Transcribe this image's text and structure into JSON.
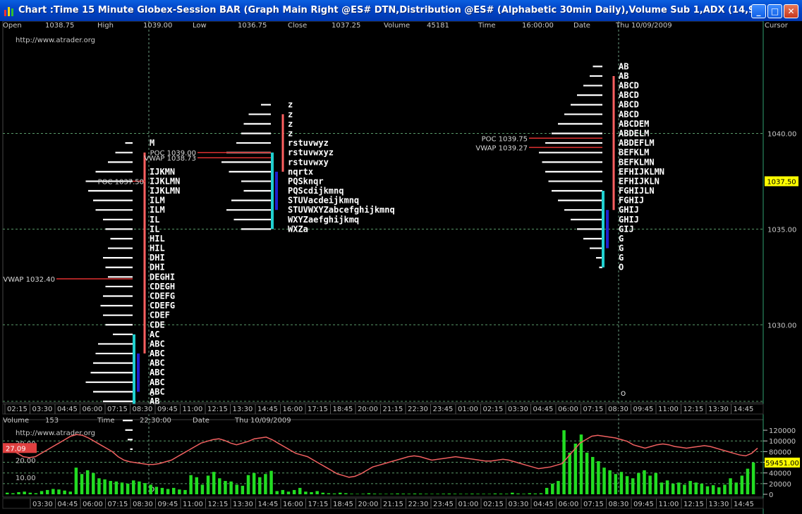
{
  "window": {
    "title": "Chart :Time 15 Minute Globex-Session BAR (Graph Main Right @ES# DTN,Distribution @ES# (Alphabetic 30min Daily),Volume Sub 1,ADX (14,9))",
    "minimize_glyph": "_",
    "maximize_glyph": "□",
    "close_glyph": "✕"
  },
  "main_header": {
    "fields": [
      {
        "label": "Open",
        "value": "1038.75"
      },
      {
        "label": "High",
        "value": "1039.00"
      },
      {
        "label": "Low",
        "value": "1036.75"
      },
      {
        "label": "Close",
        "value": "1037.25"
      },
      {
        "label": "Volume",
        "value": "45181"
      },
      {
        "label": "Time",
        "value": "16:00:00"
      },
      {
        "label": "Date",
        "value": "Thu 10/09/2009"
      }
    ],
    "cursor_label": "Cursor"
  },
  "watermark": "http://www.atrader.org",
  "colors": {
    "profile": "#ffffff",
    "poc_line": "#e03030",
    "value_area": "#ff6060",
    "ib_cyan": "#20d0d0",
    "ib_blue": "#2020d0",
    "price_highlight": "#ffff00",
    "volume_bar": "#22dd22",
    "adx_line": "#f06060",
    "grid": "#5a9a6a"
  },
  "main_axis": {
    "ticks": [
      "1040.00",
      "1035.00",
      "1030.00"
    ],
    "tick_values": [
      1040,
      1035,
      1030
    ],
    "current_price": "1037.50",
    "current_value": 1037.5
  },
  "time_axis": [
    "02:15",
    "03:30",
    "04:45",
    "06:00",
    "07:15",
    "08:30",
    "09:45",
    "11:00",
    "12:15",
    "13:30",
    "14:45",
    "16:00",
    "17:15",
    "18:45",
    "20:00",
    "21:15",
    "22:30",
    "23:45",
    "01:00",
    "02:15",
    "03:30",
    "04:45",
    "06:00",
    "07:15",
    "08:30",
    "09:45",
    "11:00",
    "12:15",
    "13:30",
    "14:45"
  ],
  "sub_time_axis": [
    "03:30",
    "04:45",
    "06:00",
    "07:15",
    "08:30",
    "09:45",
    "11:00",
    "12:15",
    "13:30",
    "14:45",
    "16:00",
    "17:15",
    "18:45",
    "20:00",
    "21:15",
    "22:30",
    "23:45",
    "01:00",
    "02:15",
    "03:30",
    "04:45",
    "06:00",
    "07:15",
    "08:30",
    "09:45",
    "11:00",
    "12:15",
    "13:30",
    "14:45"
  ],
  "sub_header": {
    "fields": [
      {
        "label": "Volume",
        "value": "153"
      },
      {
        "label": "Time",
        "value": "22:30:00"
      },
      {
        "label": "Date",
        "value": "Thu 10/09/2009"
      }
    ]
  },
  "sub_axis": {
    "ticks": [
      "120000",
      "100000",
      "80000",
      "60000",
      "40000",
      "20000",
      "0"
    ],
    "tick_values": [
      120000,
      100000,
      80000,
      60000,
      40000,
      20000,
      0
    ],
    "current_volume": "59451.00",
    "current_volume_value": 59451,
    "left_ticks": [
      "30.00",
      "20.00",
      "10.00"
    ],
    "left_tick_values": [
      30,
      20,
      10
    ],
    "adx_value": "27.09",
    "adx_value_num": 27.09
  },
  "session_markers": [
    "O",
    "O",
    "O"
  ],
  "chart_data": {
    "type": "market-profile",
    "profiles": [
      {
        "name": "session-1",
        "poc_label": "POC 1037.50",
        "poc": 1037.5,
        "vwap_label": "VWAP 1032.40",
        "vwap": 1032.4,
        "letters": [
          "M",
          "",
          "",
          "IJKMN",
          "IJKLMN",
          "IJKLMN",
          "ILM",
          "ILM",
          "IL",
          "IL",
          "HIL",
          "HIL",
          "DHI",
          "DHI",
          "DEGHI",
          "CDEGH",
          "CDEFG",
          "CDEFG",
          "CDEF",
          "CDE",
          "AC",
          "ABC",
          "ABC",
          "ABC",
          "ABC",
          "ABC",
          "ABC",
          "AB",
          "O"
        ],
        "top_price": 1039.5,
        "step": 0.5,
        "widths": [
          0.15,
          0.35,
          0.5,
          0.75,
          0.95,
          0.9,
          0.8,
          0.75,
          0.6,
          0.55,
          0.45,
          0.5,
          0.6,
          0.55,
          0.5,
          0.55,
          0.6,
          0.65,
          0.6,
          0.55,
          0.4,
          0.7,
          0.75,
          0.8,
          0.85,
          0.95,
          0.8,
          0.6,
          0.3,
          0.2,
          0.15,
          0.1,
          0.05
        ]
      },
      {
        "name": "session-2",
        "poc_label": "POC 1039.00",
        "poc": 1039.0,
        "vwap_label": "VWAP 1038.73",
        "vwap": 1038.73,
        "letters": [
          "z",
          "z",
          "z",
          "z",
          "rstuvwyz",
          "rstuvwxyz",
          "rstuvwxy",
          "nqrtx",
          "PQSknqr",
          "PQScdijkmnq",
          "STUVacdeijkmnq",
          "STUVWXYZabcefghijkmnq",
          "WXYZaefghijkmq",
          "WXZa"
        ],
        "top_price": 1041.5,
        "step": 0.5,
        "widths": [
          0.2,
          0.45,
          0.55,
          0.6,
          0.7,
          0.9,
          1.0,
          0.85,
          0.6,
          0.55,
          0.8,
          0.9,
          0.75,
          0.6
        ]
      },
      {
        "name": "session-3",
        "poc_label": "POC 1039.75",
        "poc": 1039.75,
        "vwap_label": "VWAP 1039.27",
        "vwap": 1039.27,
        "letters": [
          "AB",
          "AB",
          "ABCD",
          "ABCD",
          "ABCD",
          "ABCD",
          "ABCDEM",
          "ABDELM",
          "ABDEFLM",
          "BEFKLM",
          "BEFKLMN",
          "EFHIJKLMN",
          "EFHIJKLN",
          "FGHIJLN",
          "FGHIJ",
          "GHIJ",
          "GHIJ",
          "GIJ",
          "G",
          "G",
          "G",
          "O"
        ],
        "top_price": 1043.5,
        "step": 0.5,
        "widths": [
          0.15,
          0.2,
          0.3,
          0.4,
          0.5,
          0.6,
          0.7,
          0.8,
          0.9,
          1.0,
          0.95,
          0.9,
          0.85,
          0.8,
          0.7,
          0.6,
          0.5,
          0.4,
          0.3,
          0.2,
          0.1,
          0.05
        ]
      }
    ],
    "volume_series": {
      "name": "Volume",
      "values": [
        3000,
        2000,
        4000,
        5000,
        3000,
        2000,
        6000,
        8000,
        10000,
        9000,
        7000,
        5000,
        50000,
        38000,
        45000,
        40000,
        30000,
        28000,
        25000,
        24000,
        22000,
        20000,
        26000,
        24000,
        21000,
        18000,
        14000,
        12000,
        10000,
        12000,
        9000,
        8000,
        36000,
        32000,
        18000,
        35000,
        42000,
        30000,
        25000,
        24000,
        18000,
        16000,
        36000,
        40000,
        32000,
        38000,
        44000,
        6000,
        8000,
        5000,
        8000,
        12000,
        5000,
        4000,
        6000,
        3000,
        2000,
        1500,
        3000,
        2000,
        1000,
        800,
        1000,
        2000,
        1200,
        900,
        800,
        1000,
        1500,
        1200,
        1000,
        1400,
        1200,
        900,
        800,
        900,
        1100,
        1300,
        1000,
        900,
        800,
        1200,
        1000,
        900,
        800,
        1500,
        1200,
        1000,
        3000,
        1500,
        1000,
        2000,
        1500,
        2000,
        12000,
        20000,
        25000,
        120000,
        78000,
        95000,
        112000,
        78000,
        70000,
        62000,
        50000,
        45000,
        38000,
        42000,
        34000,
        30000,
        40000,
        45000,
        35000,
        40000,
        22000,
        26000,
        20000,
        22000,
        18000,
        25000,
        22000,
        20000,
        15000,
        17000,
        13000,
        18000,
        30000,
        22000,
        35000,
        48000,
        59451
      ]
    },
    "adx_series": {
      "name": "ADX",
      "values": [
        28,
        26,
        24,
        22,
        21.5,
        22,
        24,
        26,
        28,
        30,
        32,
        34,
        35,
        34.5,
        33,
        31,
        29,
        27,
        25,
        22,
        20,
        19,
        18.5,
        18,
        17.5,
        17.5,
        18,
        19,
        20,
        22,
        24,
        26,
        28,
        30,
        31,
        32,
        32.5,
        31.5,
        30,
        29,
        30,
        31,
        32.5,
        33,
        33.5,
        32,
        30,
        28,
        26,
        24,
        23,
        22,
        20,
        18,
        16,
        14,
        12,
        11,
        10,
        10.5,
        12,
        14,
        16,
        17,
        18,
        19,
        20,
        21,
        22,
        22.5,
        22,
        21,
        20,
        20.5,
        21,
        21.5,
        22,
        21.5,
        21,
        20.5,
        20,
        19.5,
        19.5,
        20,
        20.5,
        20,
        19,
        18,
        17,
        16,
        15,
        15.5,
        16,
        17,
        18,
        22,
        26,
        30,
        32,
        34,
        34.5,
        34,
        33.5,
        33,
        32,
        31,
        29,
        28,
        27,
        28,
        29,
        29.5,
        29,
        28,
        27.5,
        27,
        27.5,
        28,
        28.5,
        28,
        27,
        26,
        25,
        24,
        23,
        22.5,
        24,
        27
      ]
    },
    "ylim_main": [
      1026,
      1045.5
    ],
    "ylim_volume": [
      0,
      128000
    ],
    "ylim_adx": [
      0,
      40
    ]
  }
}
